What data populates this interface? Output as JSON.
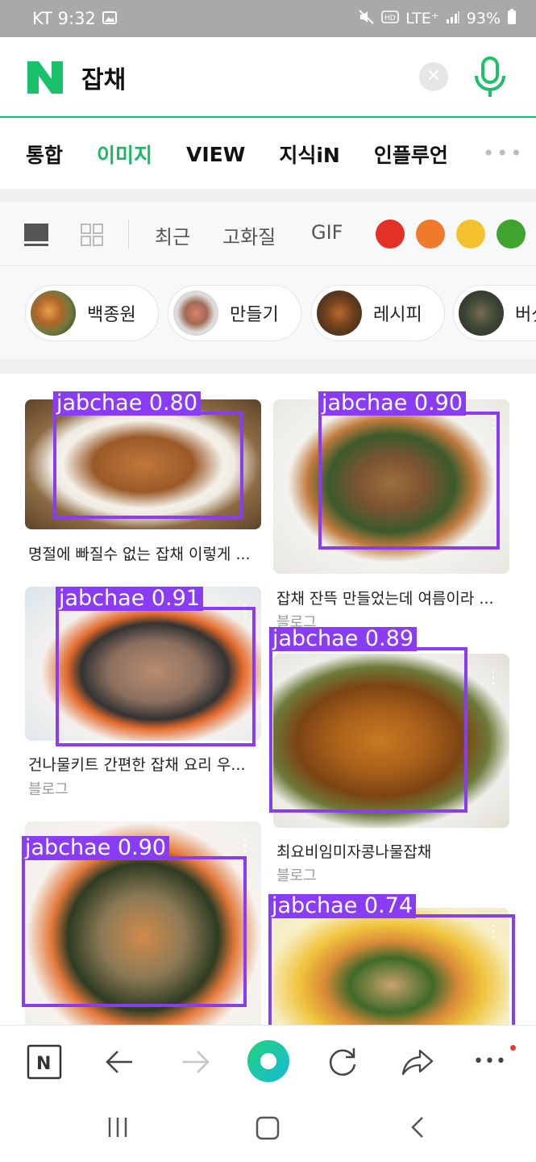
{
  "status_bar": {
    "carrier_time": "KT 9:32",
    "network": "LTE⁺",
    "battery": "93%"
  },
  "search": {
    "query": "잡채",
    "logo_letter": "N"
  },
  "tabs": [
    "통합",
    "이미지",
    "VIEW",
    "지식iN",
    "인플루언"
  ],
  "tab_more": "•••",
  "filters": {
    "recent": "최근",
    "hq": "고화질",
    "gif": "GIF"
  },
  "color_filters": [
    "#e43125",
    "#ef7a2b",
    "#f5c22f",
    "#3fa32e"
  ],
  "related": [
    "백종원",
    "만들기",
    "레시피",
    "버섯"
  ],
  "results": [
    {
      "caption": "명절에 빠질수 없는 잡채 이렇게 ...",
      "source": ""
    },
    {
      "caption": "잡채 잔뜩 만들었는데 여름이라 ...",
      "source": "블로그"
    },
    {
      "caption": "건나물키트 간편한 잡채 요리 우...",
      "source": "블로그"
    },
    {
      "caption": "최요비임미자콩나물잡채",
      "source": "블로그"
    },
    {
      "caption": "",
      "source": ""
    },
    {
      "caption": "",
      "source": ""
    }
  ],
  "detections": [
    {
      "label": "jabchae 0.80"
    },
    {
      "label": "jabchae 0.90"
    },
    {
      "label": "jabchae 0.91"
    },
    {
      "label": "jabchae 0.89"
    },
    {
      "label": "jabchae 0.90"
    },
    {
      "label": "jabchae 0.74"
    }
  ],
  "toolbar": {
    "n_label": "N",
    "more": "•••"
  },
  "colors": {
    "accent": "#19b862",
    "detection": "#8a3cf5"
  }
}
